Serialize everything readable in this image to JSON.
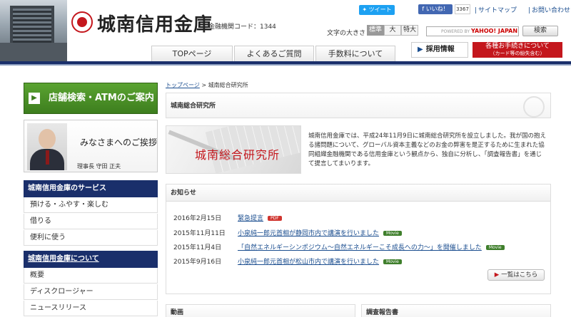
{
  "header": {
    "bank_name": "城南信用金庫",
    "institution_code": "金融機関コード：1344",
    "tweet_label": "ツイート",
    "like_label": "いいね！",
    "like_count": "3367",
    "sitemap_label": "サイトマップ",
    "contact_label": "お問い合わせ",
    "fontsize_label": "文字の大きさ",
    "fontsize_options": [
      "標準",
      "大",
      "特大"
    ],
    "search_powered": "POWERED BY",
    "search_brand": "YAHOO! JAPAN",
    "search_button": "検索",
    "nav_tabs": [
      "TOPページ",
      "よくあるご質問",
      "手数料について"
    ],
    "recruit_label": "採用情報",
    "procedure_label": "各種お手続きについて",
    "procedure_sub": "（カード等の紛失含む）"
  },
  "sidebar": {
    "shop_search": "店舗検索・ATMのご案内",
    "greeting_title": "みなさまへのご挨拶",
    "greeting_name": "理事長 守田 正夫",
    "services_heading": "城南信用金庫のサービス",
    "services_items": [
      "預ける・ふやす・楽しむ",
      "借りる",
      "便利に使う"
    ],
    "about_heading": "城南信用金庫について",
    "about_items": [
      "概要",
      "ディスクロージャー",
      "ニュースリリース"
    ]
  },
  "main": {
    "breadcrumb_home": "トップページ",
    "breadcrumb_sep": " > ",
    "breadcrumb_current": "城南総合研究所",
    "page_title": "城南総合研究所",
    "banner_label": "城南総合研究所",
    "intro_text": "城南信用金庫では、平成24年11月9日に城南総合研究所を設立しました。我が国の抱える諸問題について、グローバル資本主義などのお金の弊害を是正するために生まれた協同組織金融機関である信用金庫という観点から、独自に分析し、「調査報告書」を通じて提言してまいります。",
    "news_heading": "お知らせ",
    "news": [
      {
        "date": "2016年2月15日",
        "title": "緊急提言",
        "badge": "PDF"
      },
      {
        "date": "2015年11月11日",
        "title": "小泉純一郎元首相が静岡市内で講演を行いました",
        "badge": "Movie"
      },
      {
        "date": "2015年11月4日",
        "title": "「自然エネルギーシンポジウム〜自然エネルギーこそ成長への力〜」を開催しました",
        "badge": "Movie"
      },
      {
        "date": "2015年9月16日",
        "title": "小泉純一郎元首相が松山市内で講演を行いました",
        "badge": "Movie"
      }
    ],
    "more_label": "一覧はこちら",
    "video_heading": "動画",
    "report_heading": "調査報告書"
  },
  "colors": {
    "navy": "#1a2f6b",
    "brand_red": "#c4171d",
    "green": "#3d7e1e",
    "link": "#1a4d8f"
  }
}
